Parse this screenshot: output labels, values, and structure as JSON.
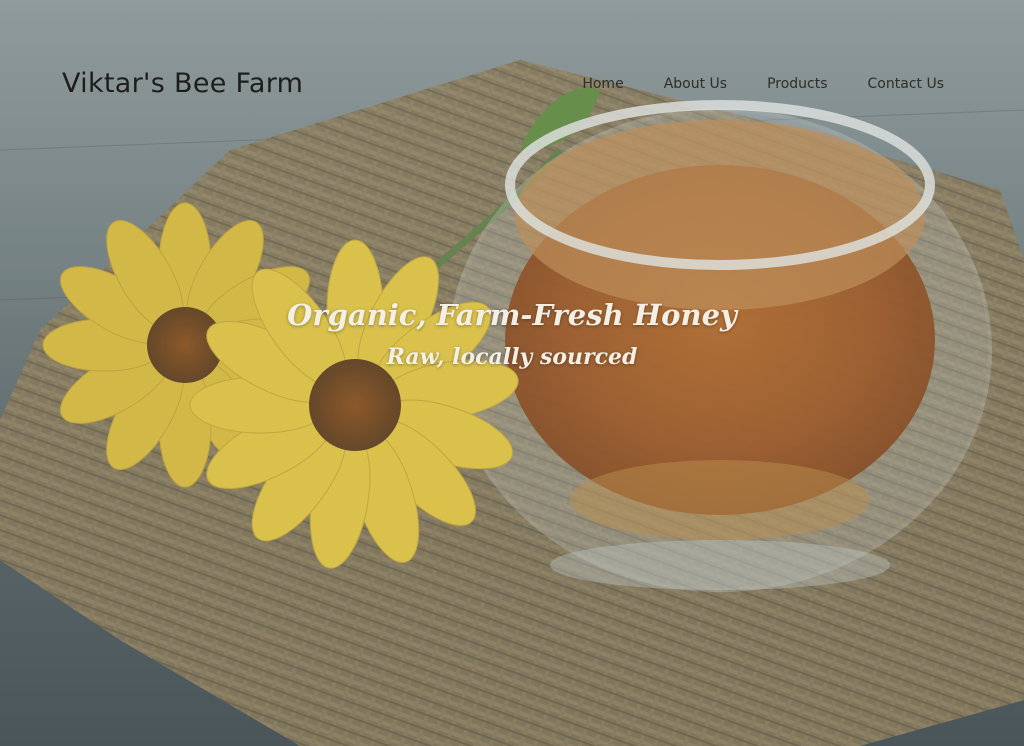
{
  "site": {
    "brand": "Viktar's Bee Farm"
  },
  "nav": {
    "items": [
      {
        "id": "home",
        "label": "Home"
      },
      {
        "id": "about",
        "label": "About Us"
      },
      {
        "id": "products",
        "label": "Products"
      },
      {
        "id": "contact",
        "label": "Contact Us"
      }
    ]
  },
  "hero": {
    "headline": "Organic, Farm-Fresh Honey",
    "subheadline": "Raw, locally sourced",
    "image_subject": "glass cup of honey with yellow flowers on burlap",
    "colors": {
      "honey": "#a8561a",
      "flower": "#e4c33a",
      "burlap": "#8f7a55",
      "table": "#4c585b"
    }
  }
}
